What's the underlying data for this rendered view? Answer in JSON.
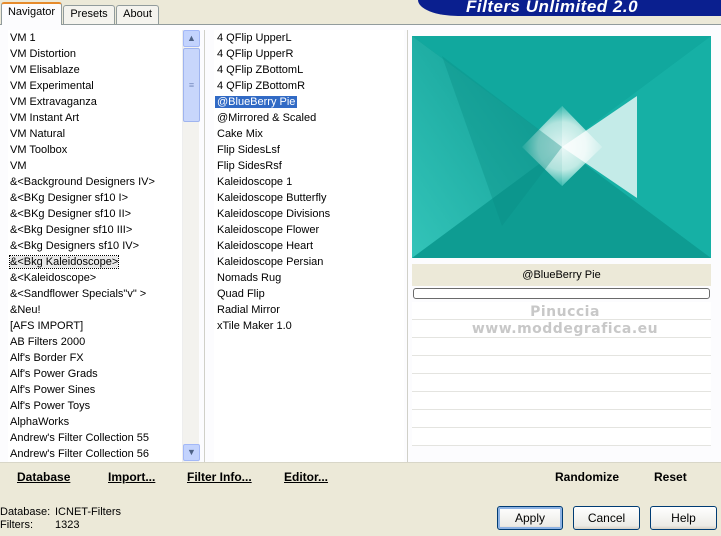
{
  "tabs": [
    "Navigator",
    "Presets",
    "About"
  ],
  "title": "Filters Unlimited 2.0",
  "categories": [
    "VM 1",
    "VM Distortion",
    "VM Elisablaze",
    "VM Experimental",
    "VM Extravaganza",
    "VM Instant Art",
    "VM Natural",
    "VM Toolbox",
    "VM",
    "&<Background Designers IV>",
    "&<BKg Designer sf10 I>",
    "&<BKg Designer sf10 II>",
    "&<Bkg Designer sf10 III>",
    "&<Bkg Designers sf10 IV>",
    "&<Bkg Kaleidoscope>",
    "&<Kaleidoscope>",
    "&<Sandflower Specials\"v\" >",
    "&Neu!",
    "[AFS IMPORT]",
    "AB Filters 2000",
    "Alf's Border FX",
    "Alf's Power Grads",
    "Alf's Power Sines",
    "Alf's Power Toys",
    "AlphaWorks",
    "Andrew's Filter Collection 55",
    "Andrew's Filter Collection 56"
  ],
  "selected_category": "&<Bkg Kaleidoscope>",
  "filters": [
    "4 QFlip UpperL",
    "4 QFlip UpperR",
    "4 QFlip ZBottomL",
    "4 QFlip ZBottomR",
    "@BlueBerry Pie",
    "@Mirrored & Scaled",
    "Cake Mix",
    "Flip SidesLsf",
    "Flip SidesRsf",
    "Kaleidoscope 1",
    "Kaleidoscope Butterfly",
    "Kaleidoscope Divisions",
    "Kaleidoscope Flower",
    "Kaleidoscope Heart",
    "Kaleidoscope Persian",
    "Nomads Rug",
    "Quad Flip",
    "Radial Mirror",
    "xTile Maker 1.0"
  ],
  "selected_filter": "@BlueBerry Pie",
  "preview_label": "@BlueBerry Pie",
  "watermark": [
    "Pinuccia",
    "www.moddegrafica.eu"
  ],
  "bottom_links": {
    "database": "Database",
    "import": "Import...",
    "filter_info": "Filter Info...",
    "editor": "Editor...",
    "randomize": "Randomize",
    "reset": "Reset"
  },
  "status": {
    "database_label": "Database:",
    "database_value": "ICNET-Filters",
    "filters_label": "Filters:",
    "filters_value": "1323"
  },
  "buttons": {
    "apply": "Apply",
    "cancel": "Cancel",
    "help": "Help"
  },
  "colors": {
    "teal": "#0fa59b",
    "selection": "#316ac5",
    "banner": "#0a1f8f"
  },
  "icons": {
    "scroll_up": "chevron-up-icon",
    "scroll_down": "chevron-down-icon"
  }
}
